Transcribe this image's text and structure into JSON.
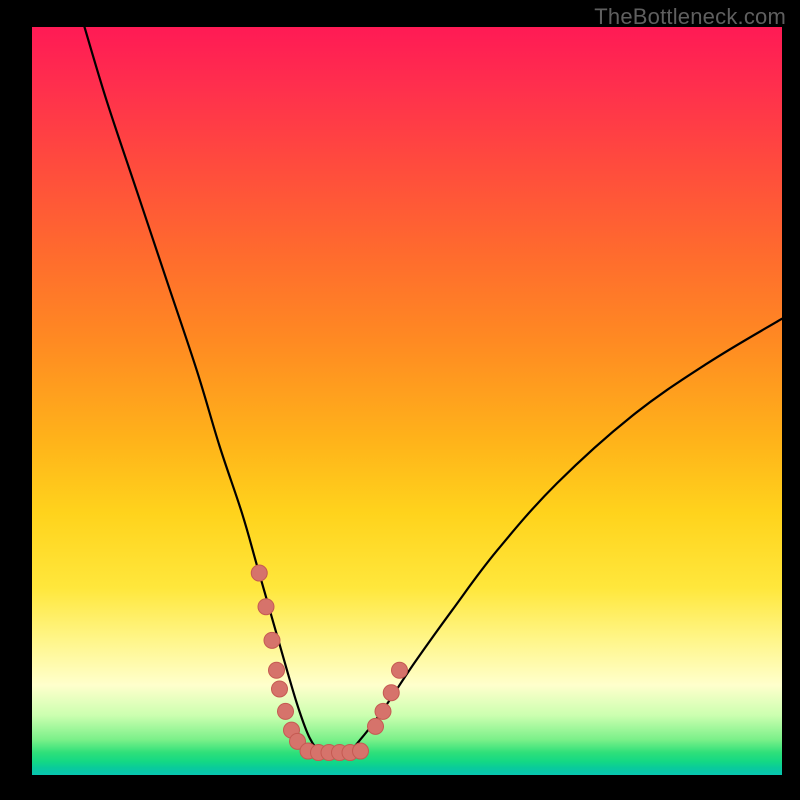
{
  "watermark": "TheBottleneck.com",
  "colors": {
    "background": "#000000",
    "gradient_top": "#ff1a55",
    "gradient_mid_orange": "#ff8a22",
    "gradient_mid_yellow": "#ffe73c",
    "gradient_pale": "#ffffcc",
    "gradient_bottom": "#07c6b0",
    "curve_stroke": "#000000",
    "dot_fill": "#d6736b",
    "dot_stroke": "#c55a52"
  },
  "chart_data": {
    "type": "line",
    "title": "",
    "xlabel": "",
    "ylabel": "",
    "xlim": [
      0,
      100
    ],
    "ylim": [
      0,
      100
    ],
    "grid": false,
    "legend": false,
    "annotations": [],
    "series": [
      {
        "name": "bottleneck-curve",
        "x": [
          7,
          10,
          14,
          18,
          22,
          25,
          28,
          30,
          32,
          34,
          35.5,
          37,
          38.5,
          40,
          42,
          44,
          47,
          51,
          56,
          62,
          70,
          80,
          90,
          100
        ],
        "y": [
          100,
          90,
          78,
          66,
          54,
          44,
          35,
          28,
          21,
          14,
          9,
          5,
          3,
          3,
          3,
          5,
          9,
          15,
          22,
          30,
          39,
          48,
          55,
          61
        ]
      }
    ],
    "markers": [
      {
        "name": "dots-left-descent",
        "x": [
          30.3,
          31.2,
          32.0,
          32.6,
          33.0,
          33.8,
          34.6,
          35.4
        ],
        "y": [
          27.0,
          22.5,
          18.0,
          14.0,
          11.5,
          8.5,
          6.0,
          4.5
        ]
      },
      {
        "name": "dots-valley-floor",
        "x": [
          36.8,
          38.2,
          39.6,
          41.0,
          42.4,
          43.8
        ],
        "y": [
          3.2,
          3.0,
          3.0,
          3.0,
          3.0,
          3.2
        ]
      },
      {
        "name": "dots-right-rise",
        "x": [
          45.8,
          46.8,
          47.9,
          49.0
        ],
        "y": [
          6.5,
          8.5,
          11.0,
          14.0
        ]
      }
    ]
  }
}
